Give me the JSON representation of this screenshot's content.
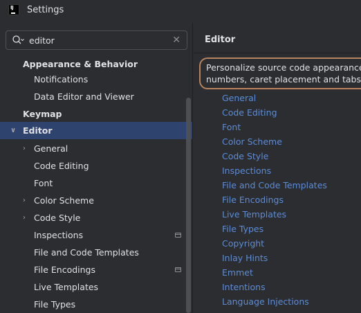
{
  "window": {
    "title": "Settings"
  },
  "search": {
    "value": "editor"
  },
  "sidebar": {
    "items": [
      {
        "label": "Appearance & Behavior"
      },
      {
        "label": "Notifications"
      },
      {
        "label": "Data Editor and Viewer"
      },
      {
        "label": "Keymap"
      },
      {
        "label": "Editor"
      },
      {
        "label": "General"
      },
      {
        "label": "Code Editing"
      },
      {
        "label": "Font"
      },
      {
        "label": "Color Scheme"
      },
      {
        "label": "Code Style"
      },
      {
        "label": "Inspections"
      },
      {
        "label": "File and Code Templates"
      },
      {
        "label": "File Encodings"
      },
      {
        "label": "Live Templates"
      },
      {
        "label": "File Types"
      }
    ]
  },
  "main": {
    "title": "Editor",
    "description_line1": "Personalize source code appearance by ch",
    "description_line2": "numbers, caret placement and tabs to sou",
    "links": [
      "General",
      "Code Editing",
      "Font",
      "Color Scheme",
      "Code Style",
      "Inspections",
      "File and Code Templates",
      "File Encodings",
      "Live Templates",
      "File Types",
      "Copyright",
      "Inlay Hints",
      "Emmet",
      "Intentions",
      "Language Injections"
    ]
  },
  "colors": {
    "background": "#2b2d30",
    "selection": "#2e436e",
    "link": "#5c8cd6",
    "highlight_border": "#b6835f"
  },
  "icons": {
    "app": "intellij-logo-icon",
    "search": "search-icon",
    "clear": "close-icon",
    "expand": "chevron-right-icon",
    "collapse": "chevron-down-icon",
    "project_scope": "window-badge-icon"
  }
}
